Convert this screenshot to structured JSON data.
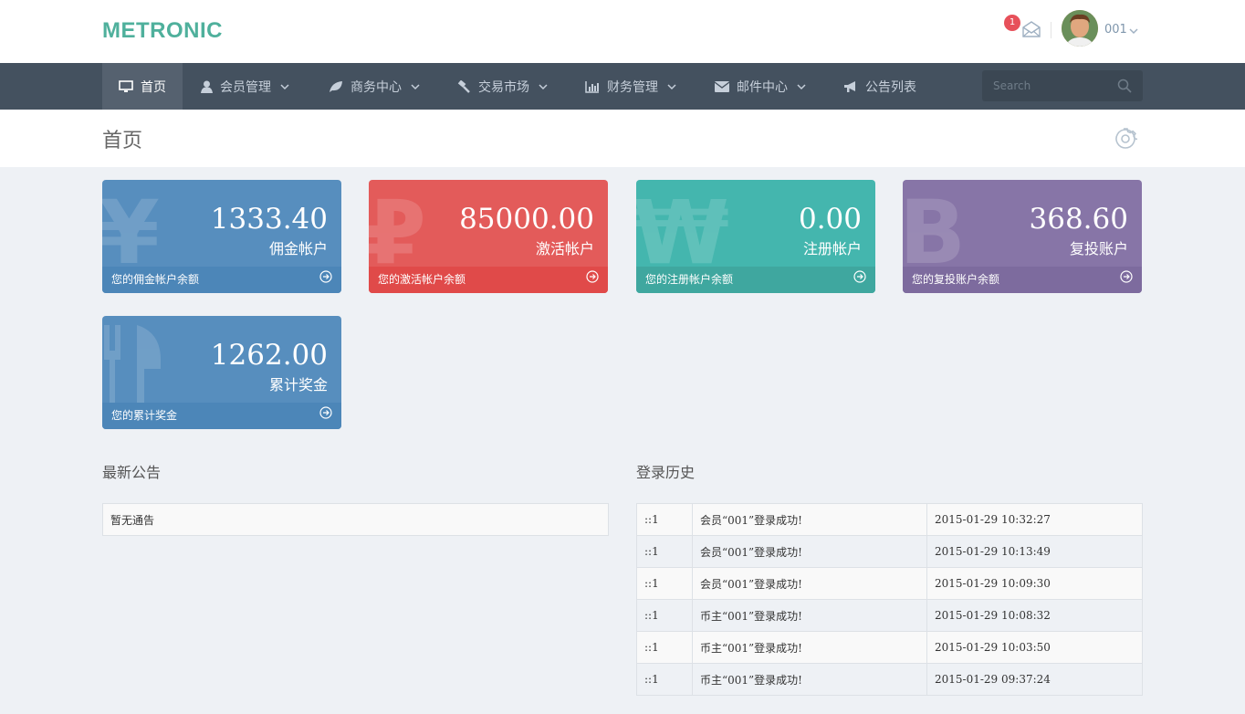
{
  "brand": {
    "logo": "METRONIC",
    "accent": "#4fb09c"
  },
  "header": {
    "mail_badge": "1",
    "username": "001"
  },
  "nav": {
    "items": [
      {
        "label": "首页",
        "icon": "desktop-icon",
        "dropdown": false
      },
      {
        "label": "会员管理",
        "icon": "user-icon",
        "dropdown": true
      },
      {
        "label": "商务中心",
        "icon": "leaf-icon",
        "dropdown": true
      },
      {
        "label": "交易市场",
        "icon": "gavel-icon",
        "dropdown": true
      },
      {
        "label": "财务管理",
        "icon": "bar-chart-icon",
        "dropdown": true
      },
      {
        "label": "邮件中心",
        "icon": "envelope-icon",
        "dropdown": true
      },
      {
        "label": "公告列表",
        "icon": "bullhorn-icon",
        "dropdown": false
      }
    ],
    "search_placeholder": "Search"
  },
  "page": {
    "title": "首页"
  },
  "cards": [
    {
      "value": "1333.40",
      "label": "佣金帐户",
      "footer": "您的佣金帐户余额",
      "symbol": "¥",
      "color": "#578ebe"
    },
    {
      "value": "85000.00",
      "label": "激活帐户",
      "footer": "您的激活帐户余额",
      "symbol": "₽",
      "color": "#e35b5a"
    },
    {
      "value": "0.00",
      "label": "注册帐户",
      "footer": "您的注册帐户余额",
      "symbol": "₩",
      "color": "#44b6ae"
    },
    {
      "value": "368.60",
      "label": "复投账户",
      "footer": "您的复投账户余额",
      "symbol": "B",
      "color": "#8775a7"
    },
    {
      "value": "1262.00",
      "label": "累计奖金",
      "footer": "您的累计奖金",
      "symbol": "cutlery",
      "color": "#578ebe"
    }
  ],
  "notices": {
    "title": "最新公告",
    "empty": "暂无通告"
  },
  "login_history": {
    "title": "登录历史",
    "rows": [
      {
        "ip": "::1",
        "msg": "会员“001”登录成功!",
        "time": "2015-01-29 10:32:27"
      },
      {
        "ip": "::1",
        "msg": "会员“001”登录成功!",
        "time": "2015-01-29 10:13:49"
      },
      {
        "ip": "::1",
        "msg": "会员“001”登录成功!",
        "time": "2015-01-29 10:09:30"
      },
      {
        "ip": "::1",
        "msg": "币主“001”登录成功!",
        "time": "2015-01-29 10:08:32"
      },
      {
        "ip": "::1",
        "msg": "币主“001”登录成功!",
        "time": "2015-01-29 10:03:50"
      },
      {
        "ip": "::1",
        "msg": "币主“001”登录成功!",
        "time": "2015-01-29 09:37:24"
      }
    ]
  }
}
